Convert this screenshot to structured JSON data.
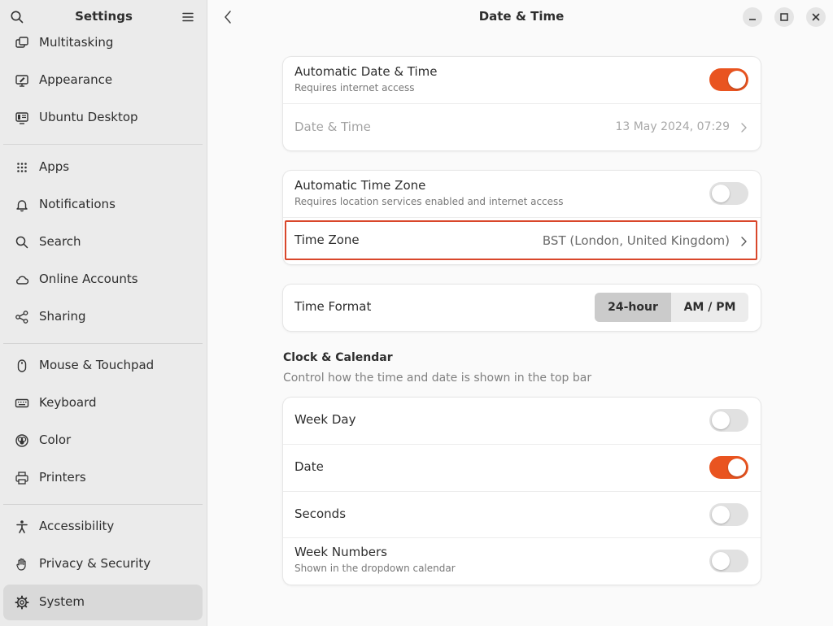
{
  "sidebar": {
    "title": "Settings",
    "items": [
      {
        "label": "Multitasking",
        "icon": "multitasking-icon"
      },
      {
        "label": "Appearance",
        "icon": "appearance-icon"
      },
      {
        "label": "Ubuntu Desktop",
        "icon": "ubuntu-desktop-icon"
      },
      {
        "label": "Apps",
        "icon": "apps-grid-icon"
      },
      {
        "label": "Notifications",
        "icon": "bell-icon"
      },
      {
        "label": "Search",
        "icon": "search-icon"
      },
      {
        "label": "Online Accounts",
        "icon": "cloud-icon"
      },
      {
        "label": "Sharing",
        "icon": "share-icon"
      },
      {
        "label": "Mouse & Touchpad",
        "icon": "mouse-icon"
      },
      {
        "label": "Keyboard",
        "icon": "keyboard-icon"
      },
      {
        "label": "Color",
        "icon": "color-icon"
      },
      {
        "label": "Printers",
        "icon": "printer-icon"
      },
      {
        "label": "Accessibility",
        "icon": "accessibility-icon"
      },
      {
        "label": "Privacy & Security",
        "icon": "hand-icon"
      },
      {
        "label": "System",
        "icon": "gear-icon",
        "active": true
      }
    ]
  },
  "header": {
    "title": "Date & Time"
  },
  "datetime_card": {
    "auto_datetime": {
      "title": "Automatic Date & Time",
      "subtitle": "Requires internet access",
      "enabled": true
    },
    "date_time": {
      "title": "Date & Time",
      "value": "13 May 2024, 07:29"
    }
  },
  "timezone_card": {
    "auto_timezone": {
      "title": "Automatic Time Zone",
      "subtitle": "Requires location services enabled and internet access",
      "enabled": false
    },
    "time_zone": {
      "title": "Time Zone",
      "value": "BST (London, United Kingdom)"
    }
  },
  "format_card": {
    "title": "Time Format",
    "options": [
      "24-hour",
      "AM / PM"
    ],
    "selected": "24-hour"
  },
  "clock_calendar": {
    "title": "Clock & Calendar",
    "description": "Control how the time and date is shown in the top bar",
    "rows": [
      {
        "title": "Week Day",
        "enabled": false
      },
      {
        "title": "Date",
        "enabled": true
      },
      {
        "title": "Seconds",
        "enabled": false
      },
      {
        "title": "Week Numbers",
        "subtitle": "Shown in the dropdown calendar",
        "enabled": false
      }
    ]
  },
  "colors": {
    "accent": "#e95420",
    "highlight_border": "#d9472b"
  }
}
